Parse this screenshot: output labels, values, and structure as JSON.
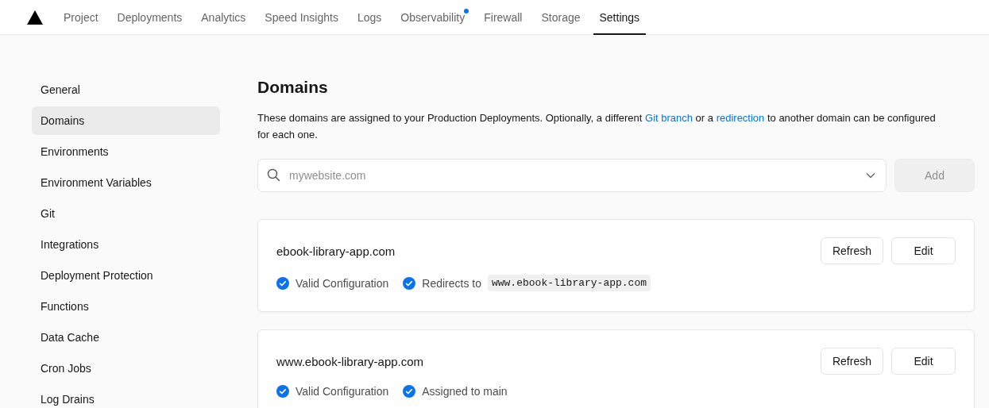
{
  "nav": {
    "tabs": [
      {
        "label": "Project",
        "selected": false,
        "dot": false
      },
      {
        "label": "Deployments",
        "selected": false,
        "dot": false
      },
      {
        "label": "Analytics",
        "selected": false,
        "dot": false
      },
      {
        "label": "Speed Insights",
        "selected": false,
        "dot": false
      },
      {
        "label": "Logs",
        "selected": false,
        "dot": false
      },
      {
        "label": "Observability",
        "selected": false,
        "dot": true
      },
      {
        "label": "Firewall",
        "selected": false,
        "dot": false
      },
      {
        "label": "Storage",
        "selected": false,
        "dot": false
      },
      {
        "label": "Settings",
        "selected": true,
        "dot": false
      }
    ]
  },
  "sidebar": {
    "items": [
      {
        "label": "General",
        "selected": false
      },
      {
        "label": "Domains",
        "selected": true
      },
      {
        "label": "Environments",
        "selected": false
      },
      {
        "label": "Environment Variables",
        "selected": false
      },
      {
        "label": "Git",
        "selected": false
      },
      {
        "label": "Integrations",
        "selected": false
      },
      {
        "label": "Deployment Protection",
        "selected": false
      },
      {
        "label": "Functions",
        "selected": false
      },
      {
        "label": "Data Cache",
        "selected": false
      },
      {
        "label": "Cron Jobs",
        "selected": false
      },
      {
        "label": "Log Drains",
        "selected": false
      }
    ]
  },
  "main": {
    "title": "Domains",
    "description": [
      {
        "kind": "text",
        "text": "These domains are assigned to your Production Deployments. Optionally, a different "
      },
      {
        "kind": "link",
        "text": "Git branch"
      },
      {
        "kind": "text",
        "text": " or a "
      },
      {
        "kind": "link",
        "text": "redirection"
      },
      {
        "kind": "text",
        "text": " to another domain can be configured for each one."
      }
    ],
    "search": {
      "placeholder": "mywebsite.com"
    },
    "add_button": {
      "label": "Add",
      "disabled": true
    },
    "domains": [
      {
        "name": "ebook-library-app.com",
        "buttons": [
          "Refresh",
          "Edit"
        ],
        "statuses": [
          {
            "label": "Valid Configuration"
          },
          {
            "label": "Redirects to",
            "code": "www.ebook-library-app.com"
          }
        ]
      },
      {
        "name": "www.ebook-library-app.com",
        "buttons": [
          "Refresh",
          "Edit"
        ],
        "statuses": [
          {
            "label": "Valid Configuration"
          },
          {
            "label": "Assigned to main"
          }
        ]
      }
    ]
  }
}
